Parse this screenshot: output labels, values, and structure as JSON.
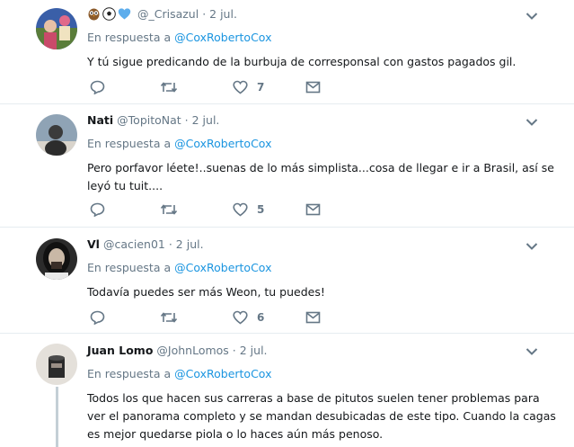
{
  "reply_prefix": "En respuesta a",
  "tweets": [
    {
      "name": "",
      "name_emoji": [
        "owl-emoji",
        "soccer-ball-emoji",
        "blue-heart-emoji"
      ],
      "handle": "@_Crisazul",
      "time": "2 jul.",
      "reply_to": "@CoxRobertoCox",
      "text": "Y tú sigue predicando de la burbuja de corresponsal con gastos pagados gil.",
      "likes": "7",
      "avatar_colors": [
        "#3a5fa8",
        "#c94a6a",
        "#5a7d3a"
      ]
    },
    {
      "name": "Nati",
      "handle": "@TopitoNat",
      "time": "2 jul.",
      "reply_to": "@CoxRobertoCox",
      "text": "Pero porfavor léete!..suenas de lo más simplista...cosa de llegar e ir a Brasil, así se leyó  tu tuit....",
      "likes": "5",
      "avatar_colors": [
        "#8fa3b5",
        "#3b3b3b",
        "#d9d4cc"
      ]
    },
    {
      "name": "Vl",
      "handle": "@cacien01",
      "time": "2 jul.",
      "reply_to": "@CoxRobertoCox",
      "text": "Todavía puedes ser más Weon, tu puedes!",
      "likes": "6",
      "avatar_colors": [
        "#2b2b2b",
        "#c9b8a6",
        "#111111"
      ]
    },
    {
      "name": "Juan Lomo",
      "handle": "@JohnLomos",
      "time": "2 jul.",
      "reply_to": "@CoxRobertoCox",
      "text": "Todos los que hacen sus carreras a base de pitutos suelen tener problemas para ver el panorama completo y se mandan desubicadas de este tipo. Cuando la cagas es mejor quedarse piola o lo haces aún más penoso.",
      "likes": "",
      "avatar_colors": [
        "#e4e0da",
        "#2a2a2a",
        "#9a8f86"
      ]
    }
  ],
  "colors": {
    "link": "#1b95e0",
    "muted": "#657786",
    "divider": "#e6ecf0"
  }
}
